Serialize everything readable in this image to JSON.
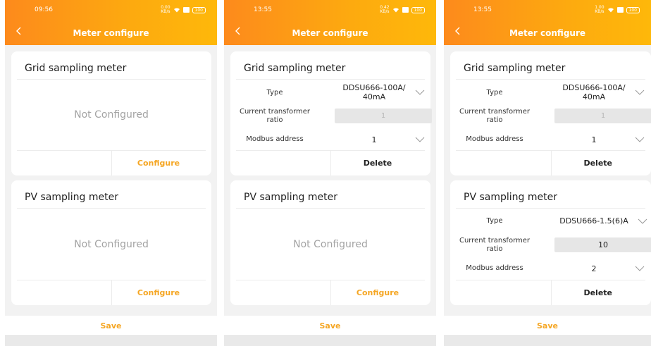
{
  "screens": [
    {
      "time": "09:56",
      "status_net": "0.00\nKB/s",
      "battery": "100",
      "title": "Meter configure",
      "grid": {
        "title": "Grid sampling meter",
        "status": "Not Configured",
        "action": "Configure"
      },
      "pv": {
        "title": "PV sampling meter",
        "status": "Not Configured",
        "action": "Configure"
      },
      "save": "Save"
    },
    {
      "time": "13:55",
      "status_net": "0.42\nKB/s",
      "battery": "100",
      "title": "Meter configure",
      "grid": {
        "title": "Grid sampling meter",
        "type_label": "Type",
        "type_value": "DDSU666-100A/\n40mA",
        "ct_label": "Current transformer\nratio",
        "ct_value": "1",
        "modbus_label": "Modbus address",
        "modbus_value": "1",
        "action": "Delete"
      },
      "pv": {
        "title": "PV sampling meter",
        "status": "Not Configured",
        "action": "Configure"
      },
      "save": "Save"
    },
    {
      "time": "13:55",
      "status_net": "1.00\nKB/s",
      "battery": "100",
      "title": "Meter configure",
      "grid": {
        "title": "Grid sampling meter",
        "type_label": "Type",
        "type_value": "DDSU666-100A/\n40mA",
        "ct_label": "Current transformer\nratio",
        "ct_value": "1",
        "modbus_label": "Modbus address",
        "modbus_value": "1",
        "action": "Delete"
      },
      "pv": {
        "title": "PV sampling meter",
        "type_label": "Type",
        "type_value": "DDSU666-1.5(6)A",
        "ct_label": "Current transformer\nratio",
        "ct_value": "10",
        "modbus_label": "Modbus address",
        "modbus_value": "2",
        "action": "Delete"
      },
      "save": "Save"
    }
  ],
  "colors": {
    "header_start": "#fd8a1c",
    "header_end": "#feb80a",
    "accent": "#f5a623",
    "placeholder": "#a3a3a3"
  },
  "icons": {
    "back": "chevron-left-icon",
    "dropdown": "chevron-down-icon",
    "wifi": "wifi-icon",
    "battery": "battery-icon"
  }
}
